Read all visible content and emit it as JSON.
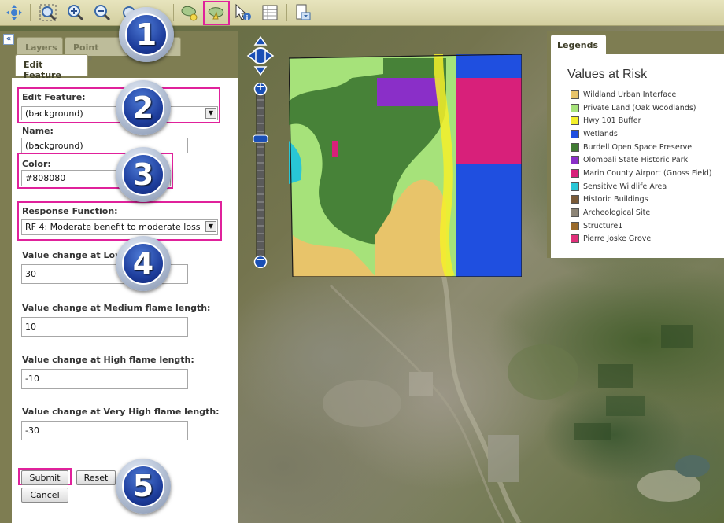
{
  "toolbar": {
    "icons": [
      "pan-icon",
      "zoom-extent-icon",
      "zoom-in-icon",
      "zoom-out-icon",
      "zoom-previous-icon",
      "add-feature-icon",
      "edit-feature-icon",
      "identify-icon",
      "attribute-table-icon",
      "print-icon"
    ]
  },
  "panel": {
    "collapse_label": "«",
    "tabs": [
      "Layers",
      "Point Info",
      "",
      "Edit Feature"
    ],
    "form": {
      "edit_feature_label": "Edit Feature:",
      "edit_feature_value": "(background)",
      "name_label": "Name:",
      "name_value": "(background)",
      "color_label": "Color:",
      "color_value": "#808080",
      "response_function_label": "Response Function:",
      "response_function_value": "RF 4: Moderate benefit to moderate loss",
      "low_label": "Value change at Low",
      "low_value": "30",
      "medium_label": "Value change at Medium flame length:",
      "medium_value": "10",
      "high_label": "Value change at High flame length:",
      "high_value": "-10",
      "very_high_label": "Value change at Very High flame length:",
      "very_high_value": "-30",
      "submit_label": "Submit",
      "reset_label": "Reset",
      "cancel_label": "Cancel"
    }
  },
  "callouts": [
    "1",
    "2",
    "3",
    "4",
    "5"
  ],
  "map_controls": {
    "zoom_in_label": "+",
    "zoom_out_label": "−"
  },
  "legends": {
    "tab_label": "Legends",
    "title": "Values at Risk",
    "items": [
      {
        "label": "Wildland Urban Interface",
        "color": "#e8c46a"
      },
      {
        "label": "Private Land (Oak Woodlands)",
        "color": "#a6e27a"
      },
      {
        "label": "Hwy 101 Buffer",
        "color": "#f4f02a"
      },
      {
        "label": "Wetlands",
        "color": "#1f4fe0"
      },
      {
        "label": "Burdell Open Space Preserve",
        "color": "#3f7a32"
      },
      {
        "label": "Olompali State Historic Park",
        "color": "#8a2fc8"
      },
      {
        "label": "Marin County Airport (Gnoss Field)",
        "color": "#d8207a"
      },
      {
        "label": "Sensitive Wildlife Area",
        "color": "#28c6d6"
      },
      {
        "label": "Historic Buildings",
        "color": "#7a5a38"
      },
      {
        "label": "Archeological Site",
        "color": "#8c8476"
      },
      {
        "label": "Structure1",
        "color": "#9a6a2a"
      },
      {
        "label": "Pierre Joske Grove",
        "color": "#e0307a"
      }
    ]
  }
}
